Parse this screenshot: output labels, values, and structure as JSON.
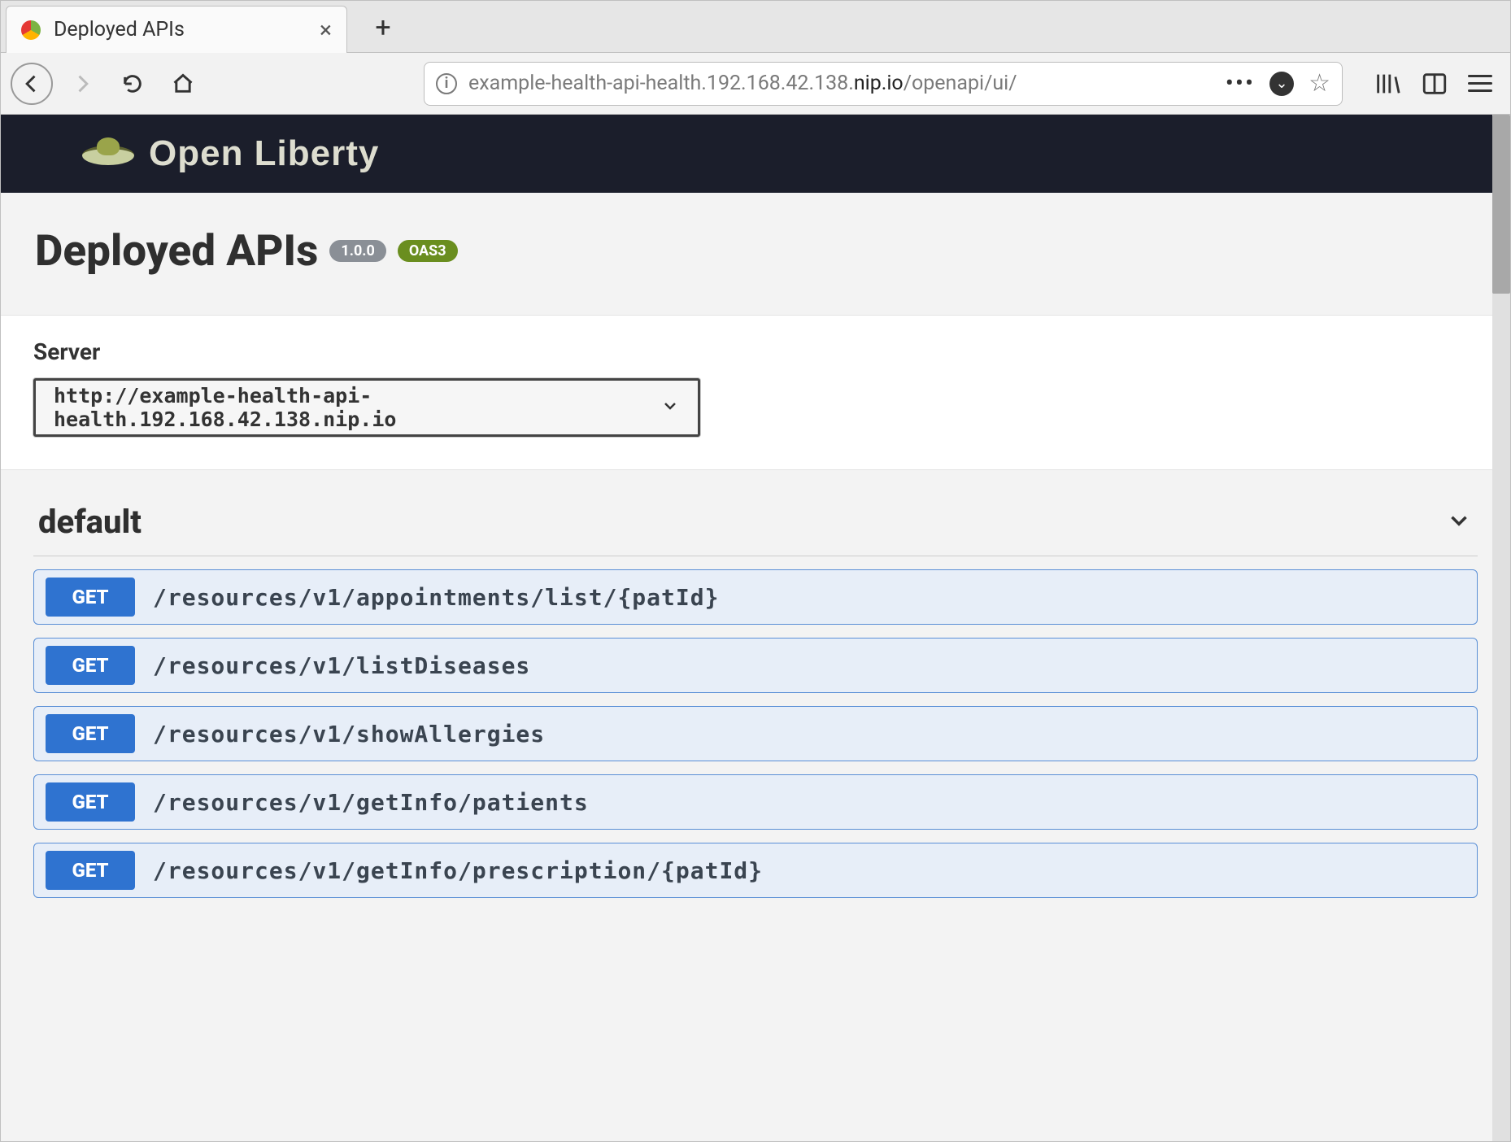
{
  "browser": {
    "tab_title": "Deployed APIs",
    "url_pre": "example-health-api-health.192.168.42.138.",
    "url_bold": "nip.io",
    "url_post": "/openapi/ui/"
  },
  "page": {
    "brand": "Open Liberty",
    "title": "Deployed APIs",
    "version_badge": "1.0.0",
    "oas_badge": "OAS3",
    "server_label": "Server",
    "server_value": "http://example-health-api-health.192.168.42.138.nip.io",
    "tag_name": "default",
    "operations": [
      {
        "method": "GET",
        "path": "/resources/v1/appointments/list/{patId}"
      },
      {
        "method": "GET",
        "path": "/resources/v1/listDiseases"
      },
      {
        "method": "GET",
        "path": "/resources/v1/showAllergies"
      },
      {
        "method": "GET",
        "path": "/resources/v1/getInfo/patients"
      },
      {
        "method": "GET",
        "path": "/resources/v1/getInfo/prescription/{patId}"
      }
    ]
  }
}
